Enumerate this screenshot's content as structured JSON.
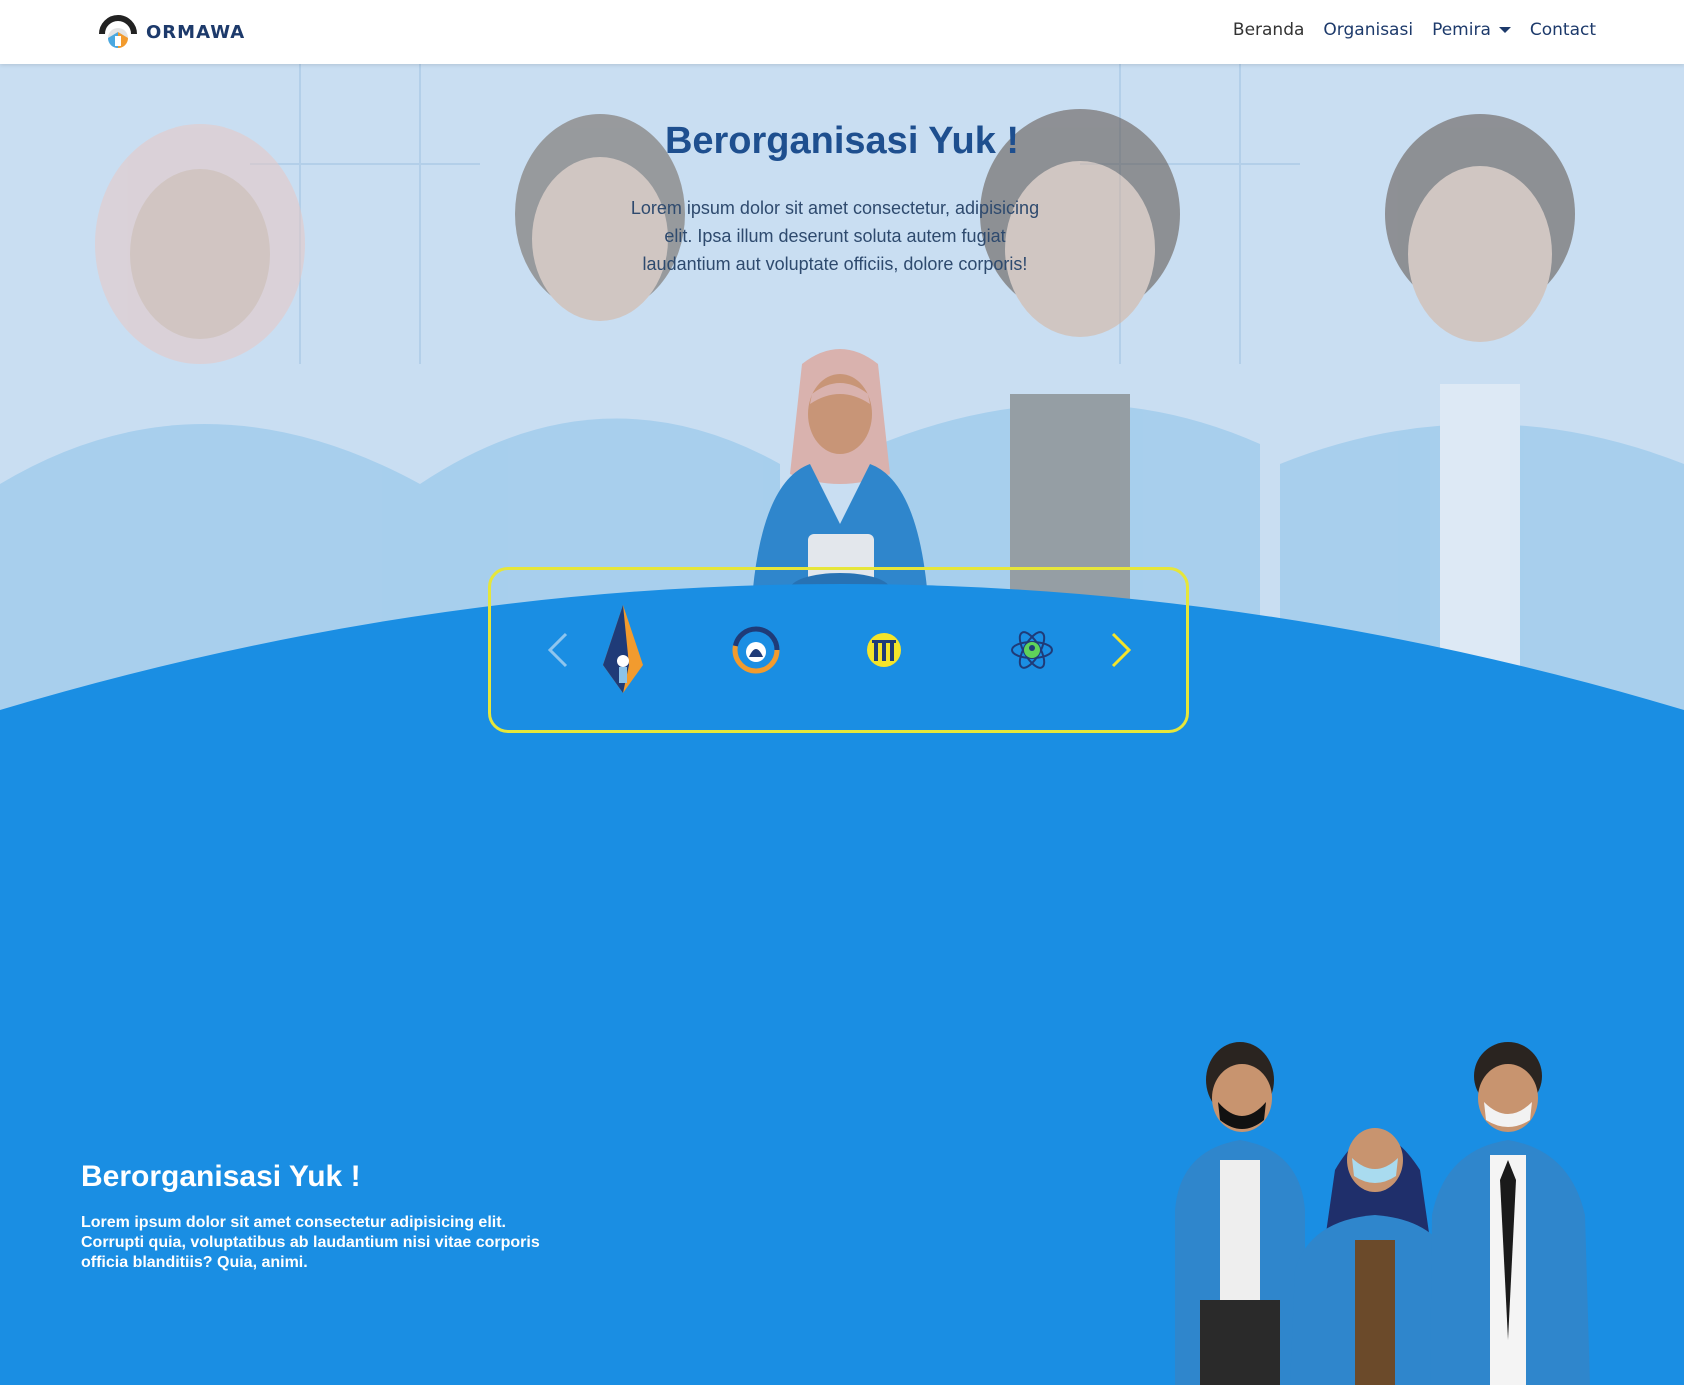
{
  "navbar": {
    "brand": "ORMAWA",
    "links": [
      {
        "label": "Beranda"
      },
      {
        "label": "Organisasi"
      },
      {
        "label": "Pemira",
        "dropdown": true
      },
      {
        "label": "Contact"
      }
    ]
  },
  "hero": {
    "title": "Berorganisasi Yuk !",
    "text": "Lorem ipsum dolor sit amet consectetur, adipisicing elit. Ipsa illum deserunt soluta autem fugiat laudantium aut voluptate officiis, dolore corporis!"
  },
  "carousel": {
    "logos": [
      "pen-nib-logo",
      "ring-logo",
      "pillar-logo",
      "atom-logo"
    ],
    "border_color": "#e6e63a"
  },
  "section2": {
    "title": "Berorganisasi Yuk !",
    "text": "Lorem ipsum dolor sit amet consectetur adipisicing elit. Corrupti quia, voluptatibus ab laudantium nisi vitae corporis officia blanditiis? Quia, animi."
  },
  "colors": {
    "primary_blue": "#1a8ee3",
    "navy": "#1d3a6b",
    "accent_yellow": "#e6e63a",
    "hero_overlay": "#cfe3f5"
  }
}
